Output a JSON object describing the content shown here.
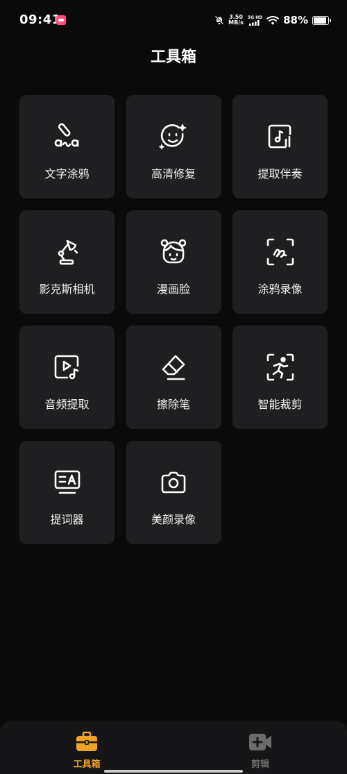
{
  "status_bar": {
    "time": "09:41",
    "net_speed_value": "3.50",
    "net_speed_unit": "MB/s",
    "signal_label": "5G HD",
    "battery_percent": "88%",
    "battery_level": 0.88
  },
  "header": {
    "title": "工具箱"
  },
  "tools": [
    {
      "label": "文字涂鸦",
      "icon": "text-doodle-icon"
    },
    {
      "label": "高清修复",
      "icon": "hd-repair-icon"
    },
    {
      "label": "提取伴奏",
      "icon": "extract-accompaniment-icon"
    },
    {
      "label": "影克斯相机",
      "icon": "lamp-camera-icon"
    },
    {
      "label": "漫画脸",
      "icon": "comic-face-icon"
    },
    {
      "label": "涂鸦录像",
      "icon": "doodle-record-icon"
    },
    {
      "label": "音频提取",
      "icon": "audio-extract-icon"
    },
    {
      "label": "擦除笔",
      "icon": "eraser-icon"
    },
    {
      "label": "智能裁剪",
      "icon": "smart-crop-icon"
    },
    {
      "label": "提词器",
      "icon": "teleprompter-icon"
    },
    {
      "label": "美颜录像",
      "icon": "beauty-camera-icon"
    }
  ],
  "tab_bar": {
    "tabs": [
      {
        "label": "工具箱",
        "icon": "toolbox-icon",
        "active": true
      },
      {
        "label": "剪辑",
        "icon": "video-add-icon",
        "active": false
      }
    ]
  },
  "colors": {
    "accent": "#f2a325",
    "tile_background": "#1f1f21",
    "background": "#0a0a0a",
    "inactive_tab": "#6b6b6b"
  }
}
